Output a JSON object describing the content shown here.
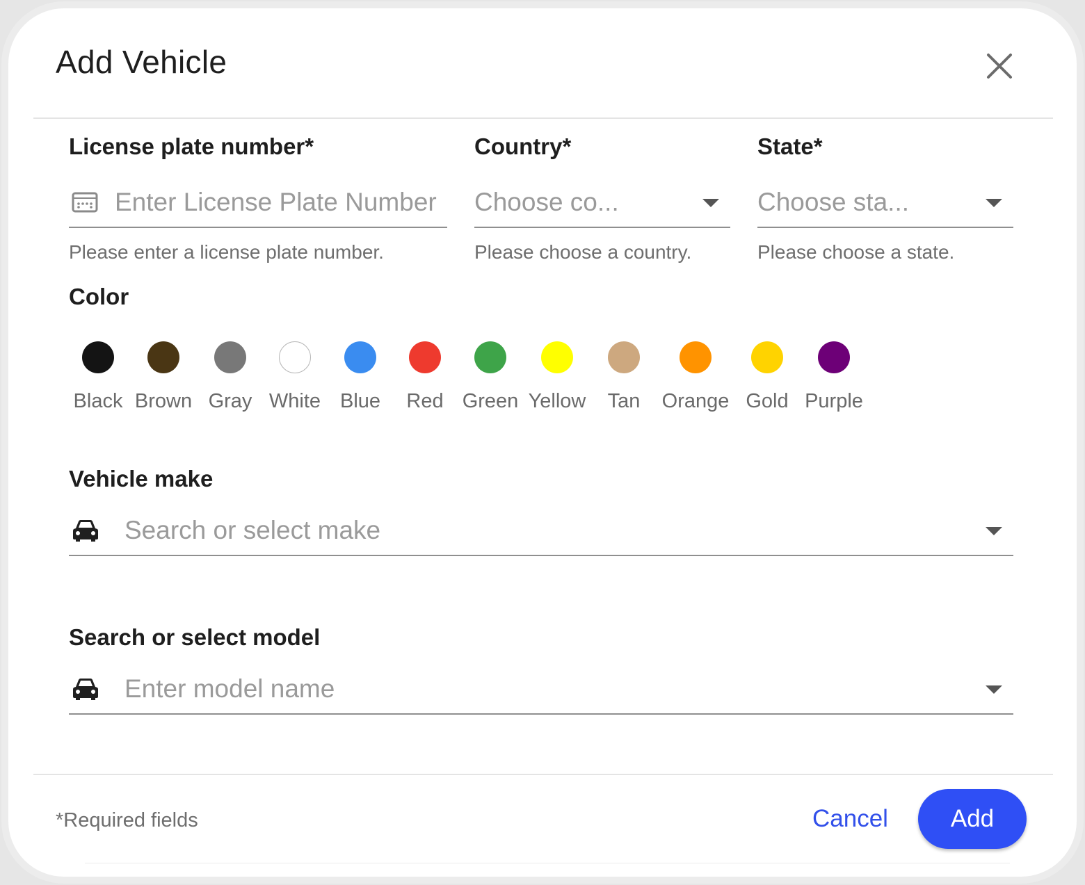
{
  "dialog": {
    "title": "Add Vehicle",
    "close_icon": "close-icon"
  },
  "license": {
    "label": "License plate number*",
    "placeholder": "Enter License Plate Number",
    "helper": "Please enter a license plate number.",
    "icon": "license-plate-icon"
  },
  "country": {
    "label": "Country*",
    "placeholder": "Choose co...",
    "helper": "Please choose a country."
  },
  "state": {
    "label": "State*",
    "placeholder": "Choose sta...",
    "helper": "Please choose a state."
  },
  "color": {
    "label": "Color",
    "options": [
      {
        "label": "Black",
        "hex": "#141414"
      },
      {
        "label": "Brown",
        "hex": "#4a3614"
      },
      {
        "label": "Gray",
        "hex": "#787878"
      },
      {
        "label": "White",
        "hex": "#ffffff"
      },
      {
        "label": "Blue",
        "hex": "#3a8cf0"
      },
      {
        "label": "Red",
        "hex": "#ee3a2e"
      },
      {
        "label": "Green",
        "hex": "#3ea449"
      },
      {
        "label": "Yellow",
        "hex": "#ffff00"
      },
      {
        "label": "Tan",
        "hex": "#cda87f"
      },
      {
        "label": "Orange",
        "hex": "#ff9300"
      },
      {
        "label": "Gold",
        "hex": "#ffd300"
      },
      {
        "label": "Purple",
        "hex": "#6d0077"
      }
    ]
  },
  "make": {
    "label": "Vehicle make",
    "placeholder": "Search or select make",
    "icon": "car-icon"
  },
  "model": {
    "label": "Search or select model",
    "placeholder": "Enter model name",
    "icon": "car-icon"
  },
  "footer": {
    "note": "*Required fields",
    "cancel_label": "Cancel",
    "add_label": "Add"
  },
  "colors": {
    "accent": "#2f4ff5",
    "link": "#3250ea"
  }
}
